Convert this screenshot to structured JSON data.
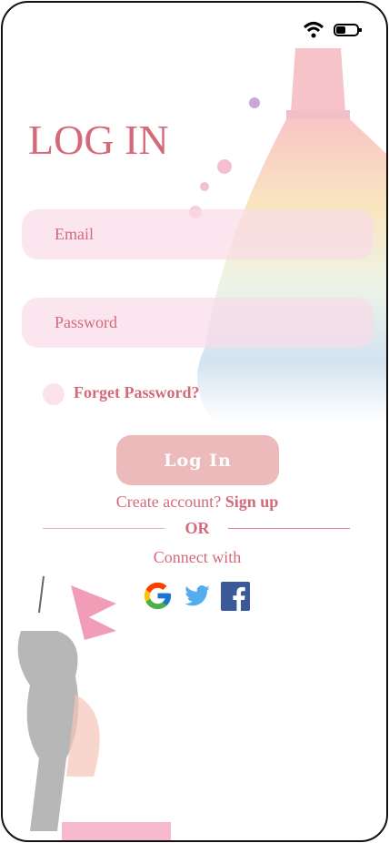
{
  "title": "LOG IN",
  "email": {
    "placeholder": "Email"
  },
  "password": {
    "placeholder": "Password"
  },
  "forgot_label": "Forget Password?",
  "login_label": "Log In",
  "create_text": "Create account?",
  "signup_label": "Sign up",
  "or_label": "OR",
  "connect_label": "Connect with",
  "social": [
    "google-icon",
    "twitter-icon",
    "facebook-icon"
  ],
  "colors": {
    "accent": "#d4697a",
    "button": "#ecbaba",
    "field": "#fbe3ec"
  }
}
